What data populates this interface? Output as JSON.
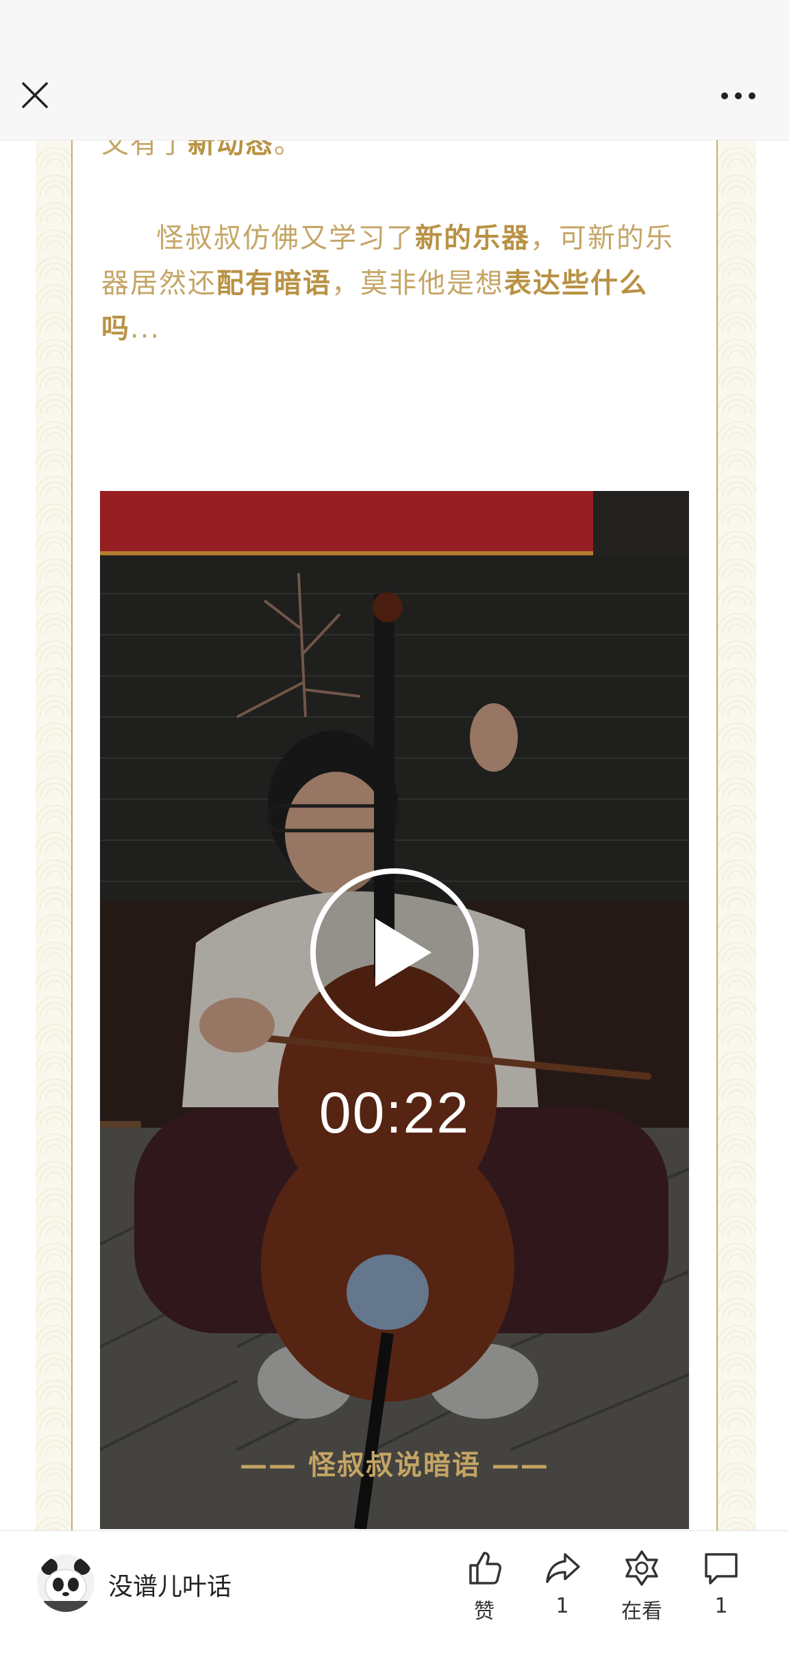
{
  "topbar": {
    "close_icon": "close-icon",
    "more_icon": "more-horizontal-icon"
  },
  "article": {
    "para1_prefix": "又有了",
    "para1_bold": "新动态",
    "para1_suffix": "。",
    "para2": [
      {
        "text": "怪叔叔仿佛又学习了",
        "bold": false
      },
      {
        "text": "新的乐器",
        "bold": true
      },
      {
        "text": "，可新的乐器居然还",
        "bold": false
      },
      {
        "text": "配有暗语",
        "bold": true
      },
      {
        "text": "，莫非他是想",
        "bold": false
      },
      {
        "text": "表达些什么吗",
        "bold": true
      },
      {
        "text": "...",
        "bold": false
      }
    ],
    "video": {
      "duration": "00:22",
      "play_icon": "play-icon"
    },
    "subhead": "—— 怪叔叔说暗语 ——"
  },
  "bottombar": {
    "account_name": "没谱儿叶话",
    "like_label": "赞",
    "share_count": "1",
    "watching_label": "在看",
    "comment_count": "1"
  },
  "colors": {
    "accent_gold": "#c4a565",
    "accent_gold_dark": "#b89244",
    "frame_line": "#c9ab72"
  }
}
